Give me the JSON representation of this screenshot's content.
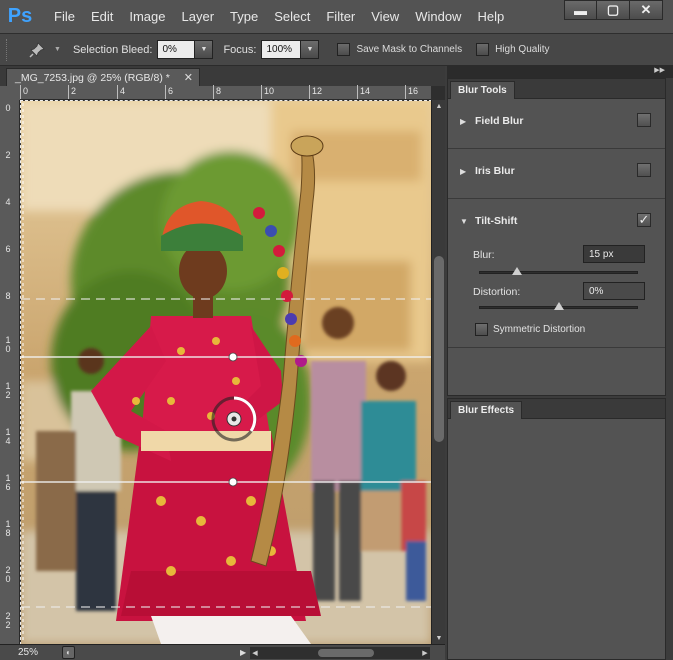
{
  "app": {
    "logo": "Ps",
    "menu": [
      "File",
      "Edit",
      "Image",
      "Layer",
      "Type",
      "Select",
      "Filter",
      "View",
      "Window",
      "Help"
    ],
    "window_controls": {
      "minimize": "▬",
      "maximize": "▢",
      "close": "✕"
    }
  },
  "options_bar": {
    "selection_bleed_label": "Selection Bleed:",
    "selection_bleed_value": "0%",
    "focus_label": "Focus:",
    "focus_value": "100%",
    "save_mask_label": "Save Mask to Channels",
    "high_quality_label": "High Quality"
  },
  "document": {
    "tab_title": "_MG_7253.jpg @ 25% (RGB/8) *",
    "tab_close": "✕",
    "ruler_top": [
      "0",
      "2",
      "4",
      "6",
      "8",
      "10",
      "12",
      "14",
      "16"
    ],
    "ruler_left": [
      "0",
      "2",
      "4",
      "6",
      "8",
      "1 0",
      "1 2",
      "1 4",
      "1 6",
      "1 8",
      "2 0",
      "2 2"
    ],
    "zoom": "25%"
  },
  "blur_tools": {
    "tab_label": "Blur Tools",
    "sections": [
      {
        "title": "Field Blur",
        "checked": false
      },
      {
        "title": "Iris Blur",
        "checked": false
      },
      {
        "title": "Tilt-Shift",
        "checked": true
      }
    ],
    "blur_label": "Blur:",
    "blur_value": "15 px",
    "distortion_label": "Distortion:",
    "distortion_value": "0%",
    "symmetric_label": "Symmetric Distortion",
    "check_glyph": "✓"
  },
  "blur_effects": {
    "tab_label": "Blur Effects"
  },
  "colors": {
    "ps_blue": "#3fa3ff",
    "panel_bg": "#535353",
    "menu_bg": "#535353"
  }
}
